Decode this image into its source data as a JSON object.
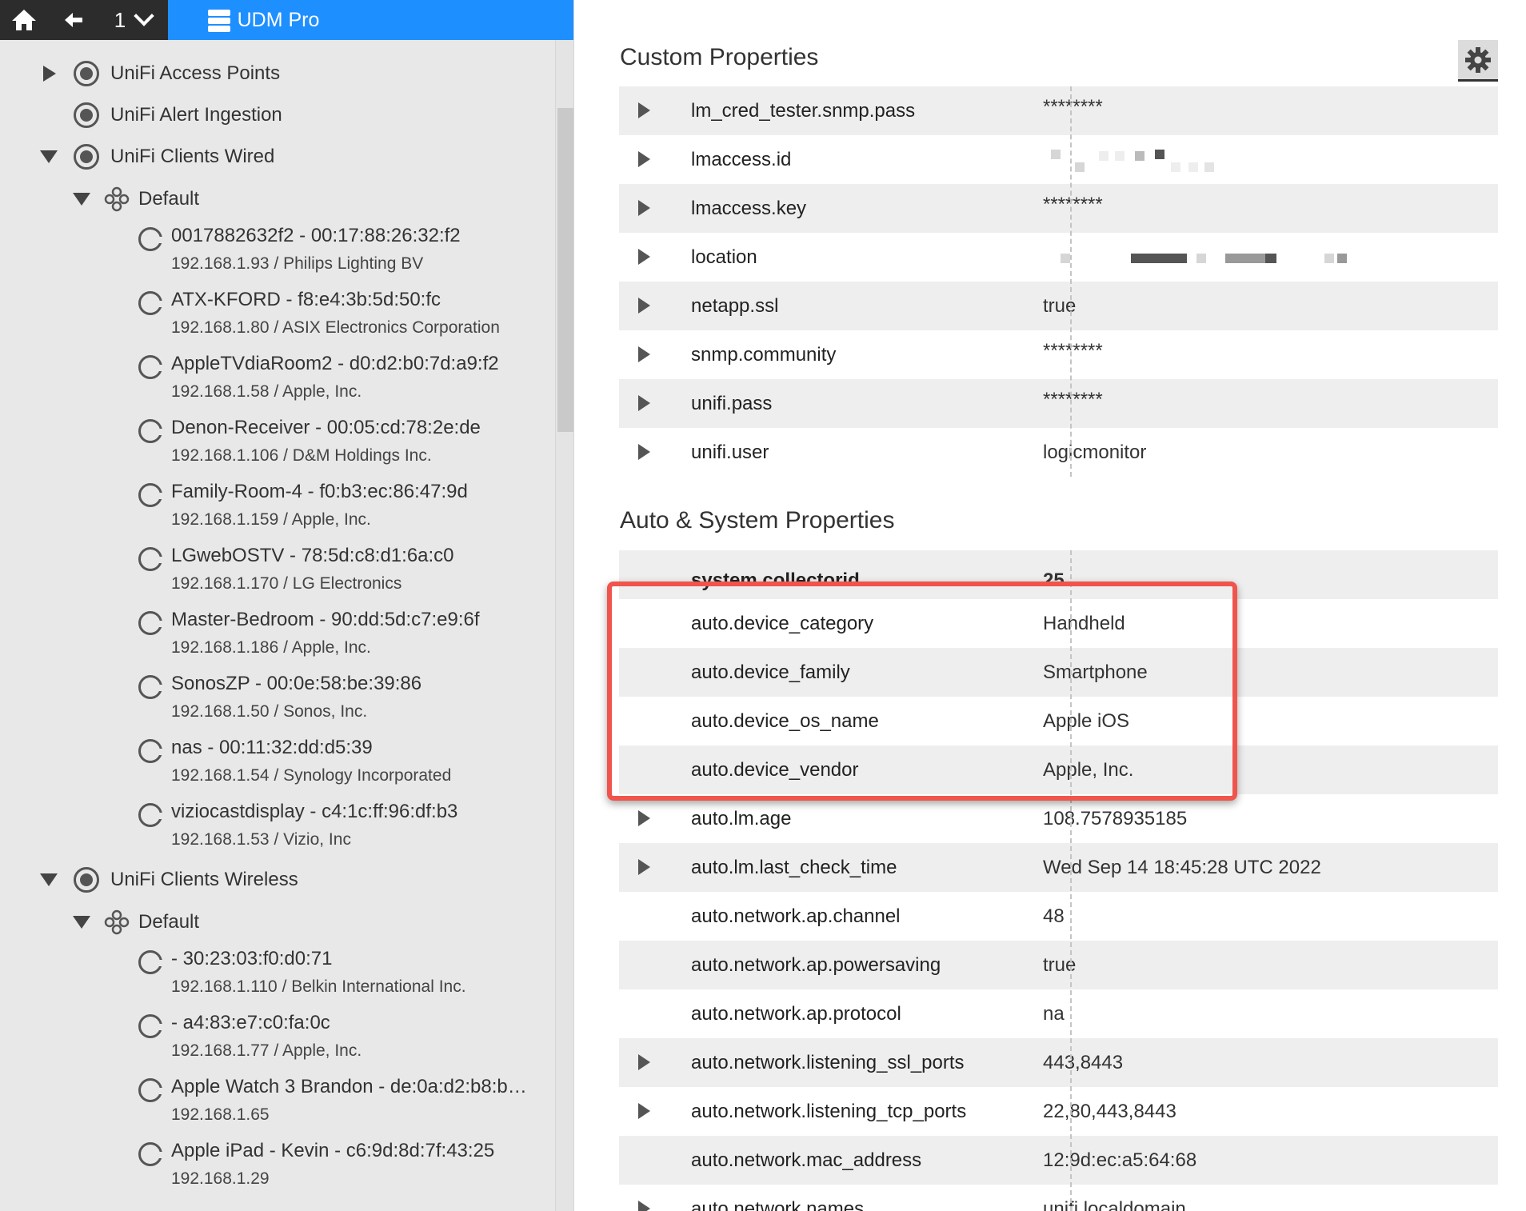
{
  "breadcrumb": {
    "level": "1",
    "title": "UDM Pro"
  },
  "tree": {
    "groups": [
      {
        "label": "UniFi Access Points"
      },
      {
        "label": "UniFi Alert Ingestion"
      },
      {
        "label": "UniFi Clients Wired"
      },
      {
        "label": "UniFi Clients Wireless"
      }
    ],
    "subgroup_label": "Default",
    "wired_devices": [
      {
        "name": "0017882632f2 - 00:17:88:26:32:f2",
        "detail": "192.168.1.93 / Philips Lighting BV"
      },
      {
        "name": "ATX-KFORD - f8:e4:3b:5d:50:fc",
        "detail": "192.168.1.80 / ASIX Electronics Corporation"
      },
      {
        "name": "AppleTVdiaRoom2 - d0:d2:b0:7d:a9:f2",
        "detail": "192.168.1.58 / Apple, Inc."
      },
      {
        "name": "Denon-Receiver - 00:05:cd:78:2e:de",
        "detail": "192.168.1.106 / D&M Holdings Inc."
      },
      {
        "name": "Family-Room-4 - f0:b3:ec:86:47:9d",
        "detail": "192.168.1.159 / Apple, Inc."
      },
      {
        "name": "LGwebOSTV - 78:5d:c8:d1:6a:c0",
        "detail": "192.168.1.170 / LG Electronics"
      },
      {
        "name": "Master-Bedroom - 90:dd:5d:c7:e9:6f",
        "detail": "192.168.1.186 / Apple, Inc."
      },
      {
        "name": "SonosZP - 00:0e:58:be:39:86",
        "detail": "192.168.1.50 / Sonos, Inc."
      },
      {
        "name": "nas - 00:11:32:dd:d5:39",
        "detail": "192.168.1.54 / Synology Incorporated"
      },
      {
        "name": "viziocastdisplay - c4:1c:ff:96:df:b3",
        "detail": "192.168.1.53 / Vizio, Inc"
      }
    ],
    "wireless_devices": [
      {
        "name": "- 30:23:03:f0:d0:71",
        "detail": "192.168.1.110 / Belkin International Inc."
      },
      {
        "name": "- a4:83:e7:c0:fa:0c",
        "detail": "192.168.1.77 / Apple, Inc."
      },
      {
        "name": "Apple Watch 3 Brandon - de:0a:d2:b8:b…",
        "detail": "192.168.1.65"
      },
      {
        "name": "Apple iPad - Kevin - c6:9d:8d:7f:43:25",
        "detail": "192.168.1.29"
      }
    ]
  },
  "custom_properties": {
    "title": "Custom Properties",
    "rows": [
      {
        "name": "lm_cred_tester.snmp.pass",
        "value": "********"
      },
      {
        "name": "lmaccess.id",
        "value": ""
      },
      {
        "name": "lmaccess.key",
        "value": "********"
      },
      {
        "name": "location",
        "value": ""
      },
      {
        "name": "netapp.ssl",
        "value": "true"
      },
      {
        "name": "snmp.community",
        "value": "********"
      },
      {
        "name": "unifi.pass",
        "value": "********"
      },
      {
        "name": "unifi.user",
        "value": "logicmonitor"
      }
    ]
  },
  "auto_properties": {
    "title": "Auto & System Properties",
    "rows": [
      {
        "name": "system.collectorid",
        "value": "25"
      },
      {
        "name": "auto.device_category",
        "value": "Handheld"
      },
      {
        "name": "auto.device_family",
        "value": "Smartphone"
      },
      {
        "name": "auto.device_os_name",
        "value": "Apple iOS"
      },
      {
        "name": "auto.device_vendor",
        "value": "Apple, Inc."
      },
      {
        "name": "auto.lm.age",
        "value": "108.7578935185"
      },
      {
        "name": "auto.lm.last_check_time",
        "value": "Wed Sep 14 18:45:28 UTC 2022"
      },
      {
        "name": "auto.network.ap.channel",
        "value": "48"
      },
      {
        "name": "auto.network.ap.powersaving",
        "value": "true"
      },
      {
        "name": "auto.network.ap.protocol",
        "value": "na"
      },
      {
        "name": "auto.network.listening_ssl_ports",
        "value": "443,8443"
      },
      {
        "name": "auto.network.listening_tcp_ports",
        "value": "22,80,443,8443"
      },
      {
        "name": "auto.network.mac_address",
        "value": "12:9d:ec:a5:64:68"
      },
      {
        "name": "auto.network.names",
        "value": "unifi.localdomain"
      }
    ]
  },
  "icons": {
    "home": "home-icon",
    "back": "back-arrow-icon",
    "server": "server-icon",
    "settings": "gear-icon"
  },
  "colors": {
    "accent": "#1e8fff",
    "highlight": "#f0544c"
  }
}
